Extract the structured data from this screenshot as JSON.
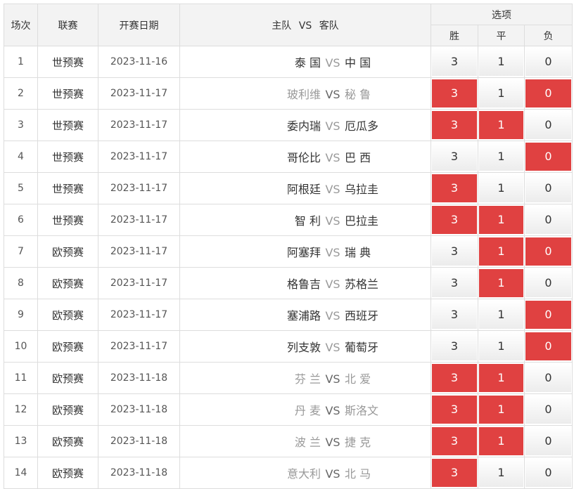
{
  "headers": {
    "num": "场次",
    "league": "联赛",
    "date": "开赛日期",
    "home": "主队",
    "vs": "VS",
    "away": "客队",
    "options": "选项",
    "win": "胜",
    "draw": "平",
    "lose": "负"
  },
  "colors": {
    "selected": "#e04141",
    "header_bg": "#f3f3f3",
    "border": "#dddddd"
  },
  "rows": [
    {
      "num": "1",
      "league": "世预赛",
      "date": "2023-11-16",
      "home": "泰 国",
      "vs": "VS",
      "away": "中 国",
      "w": "3",
      "d": "1",
      "l": "0",
      "sel": [
        false,
        false,
        false
      ],
      "muted": false,
      "vs_bold": false
    },
    {
      "num": "2",
      "league": "世预赛",
      "date": "2023-11-17",
      "home": "玻利维",
      "vs": "VS",
      "away": "秘 鲁",
      "w": "3",
      "d": "1",
      "l": "0",
      "sel": [
        true,
        false,
        true
      ],
      "muted": true,
      "vs_bold": true
    },
    {
      "num": "3",
      "league": "世预赛",
      "date": "2023-11-17",
      "home": "委内瑞",
      "vs": "VS",
      "away": "厄瓜多",
      "w": "3",
      "d": "1",
      "l": "0",
      "sel": [
        true,
        true,
        false
      ],
      "muted": false,
      "vs_bold": false
    },
    {
      "num": "4",
      "league": "世预赛",
      "date": "2023-11-17",
      "home": "哥伦比",
      "vs": "VS",
      "away": "巴 西",
      "w": "3",
      "d": "1",
      "l": "0",
      "sel": [
        false,
        false,
        true
      ],
      "muted": false,
      "vs_bold": false
    },
    {
      "num": "5",
      "league": "世预赛",
      "date": "2023-11-17",
      "home": "阿根廷",
      "vs": "VS",
      "away": "乌拉圭",
      "w": "3",
      "d": "1",
      "l": "0",
      "sel": [
        true,
        false,
        false
      ],
      "muted": false,
      "vs_bold": false
    },
    {
      "num": "6",
      "league": "世预赛",
      "date": "2023-11-17",
      "home": "智 利",
      "vs": "VS",
      "away": "巴拉圭",
      "w": "3",
      "d": "1",
      "l": "0",
      "sel": [
        true,
        true,
        false
      ],
      "muted": false,
      "vs_bold": false
    },
    {
      "num": "7",
      "league": "欧预赛",
      "date": "2023-11-17",
      "home": "阿塞拜",
      "vs": "VS",
      "away": "瑞 典",
      "w": "3",
      "d": "1",
      "l": "0",
      "sel": [
        false,
        true,
        true
      ],
      "muted": false,
      "vs_bold": false
    },
    {
      "num": "8",
      "league": "欧预赛",
      "date": "2023-11-17",
      "home": "格鲁吉",
      "vs": "VS",
      "away": "苏格兰",
      "w": "3",
      "d": "1",
      "l": "0",
      "sel": [
        false,
        true,
        false
      ],
      "muted": false,
      "vs_bold": false
    },
    {
      "num": "9",
      "league": "欧预赛",
      "date": "2023-11-17",
      "home": "塞浦路",
      "vs": "VS",
      "away": "西班牙",
      "w": "3",
      "d": "1",
      "l": "0",
      "sel": [
        false,
        false,
        true
      ],
      "muted": false,
      "vs_bold": false
    },
    {
      "num": "10",
      "league": "欧预赛",
      "date": "2023-11-17",
      "home": "列支敦",
      "vs": "VS",
      "away": "葡萄牙",
      "w": "3",
      "d": "1",
      "l": "0",
      "sel": [
        false,
        false,
        true
      ],
      "muted": false,
      "vs_bold": false
    },
    {
      "num": "11",
      "league": "欧预赛",
      "date": "2023-11-18",
      "home": "芬 兰",
      "vs": "VS",
      "away": "北 爱",
      "w": "3",
      "d": "1",
      "l": "0",
      "sel": [
        true,
        true,
        false
      ],
      "muted": true,
      "vs_bold": true
    },
    {
      "num": "12",
      "league": "欧预赛",
      "date": "2023-11-18",
      "home": "丹 麦",
      "vs": "VS",
      "away": "斯洛文",
      "w": "3",
      "d": "1",
      "l": "0",
      "sel": [
        true,
        true,
        false
      ],
      "muted": true,
      "vs_bold": true
    },
    {
      "num": "13",
      "league": "欧预赛",
      "date": "2023-11-18",
      "home": "波 兰",
      "vs": "VS",
      "away": "捷 克",
      "w": "3",
      "d": "1",
      "l": "0",
      "sel": [
        true,
        true,
        false
      ],
      "muted": true,
      "vs_bold": true
    },
    {
      "num": "14",
      "league": "欧预赛",
      "date": "2023-11-18",
      "home": "意大利",
      "vs": "VS",
      "away": "北 马",
      "w": "3",
      "d": "1",
      "l": "0",
      "sel": [
        true,
        false,
        false
      ],
      "muted": true,
      "vs_bold": true
    }
  ]
}
